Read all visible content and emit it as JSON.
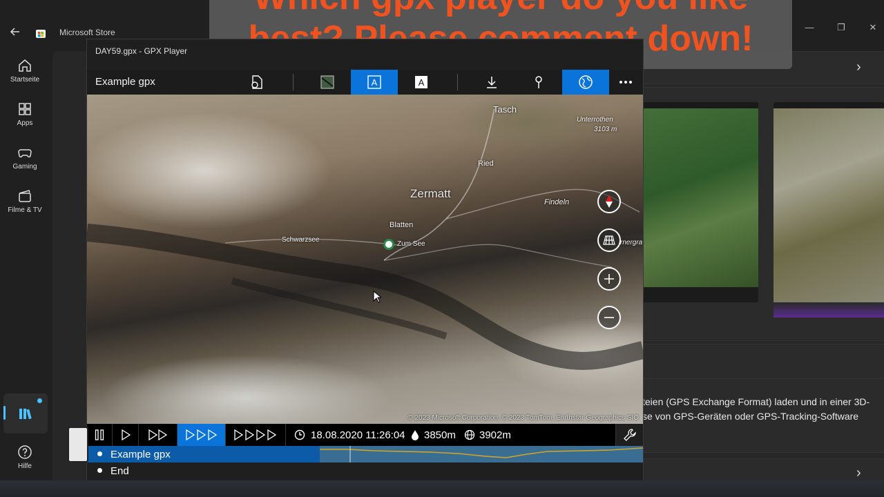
{
  "store": {
    "title": "Microsoft Store",
    "nav": [
      {
        "label": "Startseite",
        "icon": "home-icon"
      },
      {
        "label": "Apps",
        "icon": "apps-icon"
      },
      {
        "label": "Gaming",
        "icon": "gamepad-icon"
      },
      {
        "label": "Filme & TV",
        "icon": "film-icon"
      },
      {
        "label": "",
        "icon": "library-icon"
      },
      {
        "label": "Hilfe",
        "icon": "help-icon"
      }
    ],
    "description_line1": "teien (GPS Exchange Format) laden und in einer 3D-",
    "description_line2": "se von GPS-Geräten oder GPS-Tracking-Software"
  },
  "banner": {
    "line1": "Which gpx player do you like",
    "line2": "best? Please comment down!"
  },
  "gpx_window": {
    "title": "DAY59.gpx - GPX Player",
    "track_name": "Example gpx",
    "toolbar": [
      "open-file-icon",
      "terrain-icon",
      "label-a-icon",
      "label-a-outline-icon",
      "download-icon",
      "pin-icon",
      "globe-icon",
      "more-icon"
    ],
    "map_labels": {
      "tasch": "Tasch",
      "unterrothen": "Unterrothen",
      "unterrothen_elev": "3103 m",
      "ried": "Ried",
      "zermatt": "Zermatt",
      "findeln": "Findeln",
      "blatten": "Blatten",
      "schwarzsee": "Schwarzsee",
      "zum_see": "Zum See",
      "gornergrat_partial": "rnergra"
    },
    "copyright": "© 2023 Microsoft Corporation, © 2023 TomTom, Earthstar Geographics  SIO",
    "playback": {
      "timestamp": "18.08.2020 11:26:04",
      "altitude": "3850m",
      "global_altitude": "3902m"
    },
    "tracks": [
      {
        "label": "Example gpx",
        "selected": true
      },
      {
        "label": "End",
        "selected": false
      }
    ]
  },
  "colors": {
    "accent": "#0a74da",
    "banner_text": "#f0531f",
    "elevation_line": "#d9a520"
  }
}
